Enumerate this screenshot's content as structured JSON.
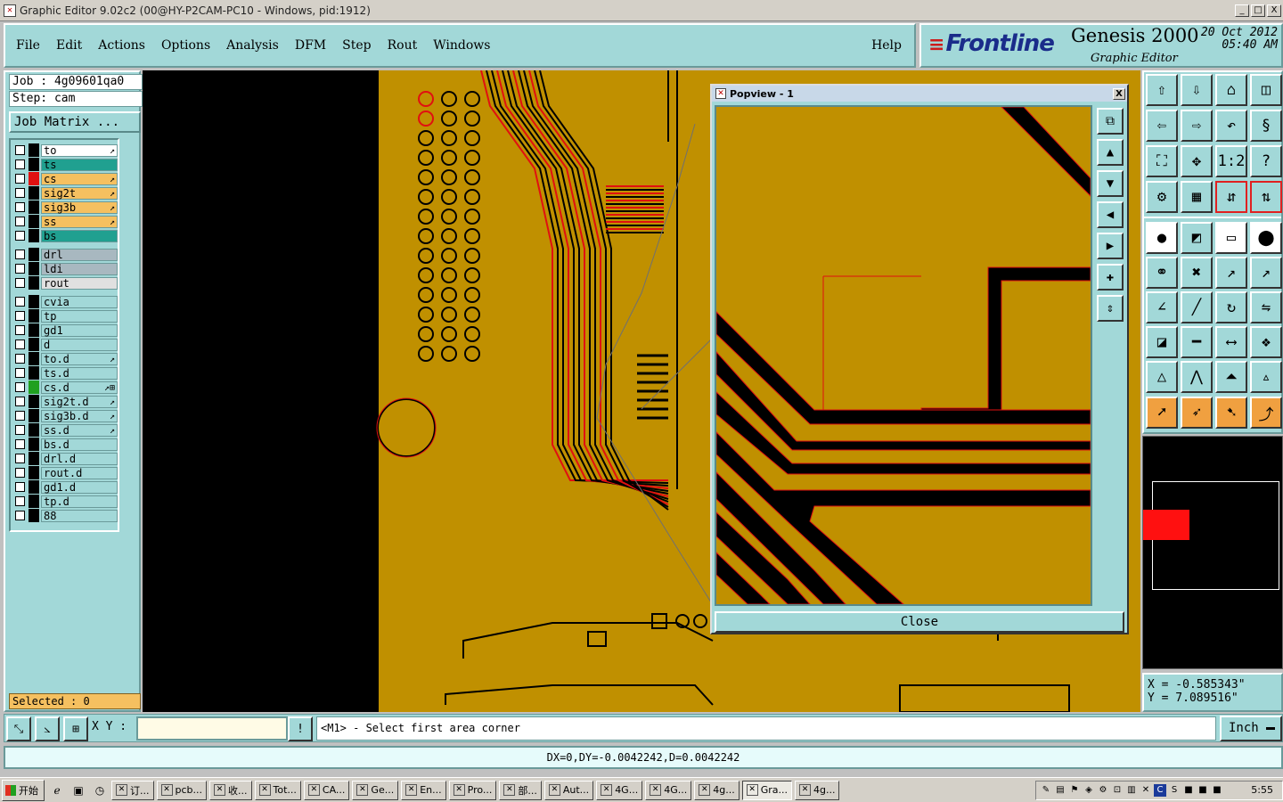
{
  "window": {
    "title": "Graphic Editor 9.02c2 (00@HY-P2CAM-PC10 - Windows, pid:1912)",
    "btn_min": "_",
    "btn_max": "□",
    "btn_close": "X"
  },
  "menu": {
    "file": "File",
    "edit": "Edit",
    "actions": "Actions",
    "options": "Options",
    "analysis": "Analysis",
    "dfm": "DFM",
    "step": "Step",
    "rout": "Rout",
    "windows": "Windows",
    "help": "Help"
  },
  "logo": {
    "brand": "Frontline",
    "product": "Genesis 2000",
    "subtitle": "Graphic Editor",
    "date": "20 Oct 2012",
    "time": "05:40 AM"
  },
  "panel": {
    "job": "Job : 4g09601qa0",
    "step": "Step: cam",
    "job_matrix": "Job Matrix ...",
    "selected": "Selected : 0"
  },
  "layers": [
    {
      "name": "to",
      "bg": "#ffffff",
      "swatch": "#000000",
      "flag": "↗"
    },
    {
      "name": "ts",
      "bg": "#20a090",
      "swatch": "#000000",
      "flag": ""
    },
    {
      "name": "cs",
      "bg": "#f5c060",
      "swatch": "#e01010",
      "flag": "↗"
    },
    {
      "name": "sig2t",
      "bg": "#f5c060",
      "swatch": "#000000",
      "flag": "↗"
    },
    {
      "name": "sig3b",
      "bg": "#f5c060",
      "swatch": "#000000",
      "flag": "↗"
    },
    {
      "name": "ss",
      "bg": "#f5c060",
      "swatch": "#000000",
      "flag": "↗"
    },
    {
      "name": "bs",
      "bg": "#20a090",
      "swatch": "#000000",
      "flag": ""
    },
    {
      "name": "drl",
      "bg": "#a8b8c0",
      "swatch": "#000000",
      "flag": ""
    },
    {
      "name": "ldi",
      "bg": "#a8b8c0",
      "swatch": "#000000",
      "flag": ""
    },
    {
      "name": "rout",
      "bg": "#e0e0e0",
      "swatch": "#000000",
      "flag": ""
    },
    {
      "name": "cvia",
      "bg": "#a2d8d8",
      "swatch": "#000000",
      "flag": ""
    },
    {
      "name": "tp",
      "bg": "#a2d8d8",
      "swatch": "#000000",
      "flag": ""
    },
    {
      "name": "gd1",
      "bg": "#a2d8d8",
      "swatch": "#000000",
      "flag": ""
    },
    {
      "name": "d",
      "bg": "#a2d8d8",
      "swatch": "#000000",
      "flag": ""
    },
    {
      "name": "to.d",
      "bg": "#a2d8d8",
      "swatch": "#000000",
      "flag": "↗"
    },
    {
      "name": "ts.d",
      "bg": "#a2d8d8",
      "swatch": "#000000",
      "flag": ""
    },
    {
      "name": "cs.d",
      "bg": "#a2d8d8",
      "swatch": "#20a020",
      "flag": "↗⊞"
    },
    {
      "name": "sig2t.d",
      "bg": "#a2d8d8",
      "swatch": "#000000",
      "flag": "↗"
    },
    {
      "name": "sig3b.d",
      "bg": "#a2d8d8",
      "swatch": "#000000",
      "flag": "↗"
    },
    {
      "name": "ss.d",
      "bg": "#a2d8d8",
      "swatch": "#000000",
      "flag": "↗"
    },
    {
      "name": "bs.d",
      "bg": "#a2d8d8",
      "swatch": "#000000",
      "flag": ""
    },
    {
      "name": "drl.d",
      "bg": "#a2d8d8",
      "swatch": "#000000",
      "flag": ""
    },
    {
      "name": "rout.d",
      "bg": "#a2d8d8",
      "swatch": "#000000",
      "flag": ""
    },
    {
      "name": "gd1.d",
      "bg": "#a2d8d8",
      "swatch": "#000000",
      "flag": ""
    },
    {
      "name": "tp.d",
      "bg": "#a2d8d8",
      "swatch": "#000000",
      "flag": ""
    },
    {
      "name": "88",
      "bg": "#a2d8d8",
      "swatch": "#000000",
      "flag": ""
    }
  ],
  "popview": {
    "title": "Popview - 1",
    "close_btn": "Close",
    "close_x": "X"
  },
  "coords": {
    "x": "X = -0.585343\"",
    "y": "Y = 7.089516\""
  },
  "command": {
    "xy_label": "X Y :",
    "xy_value": "",
    "prompt": "<M1> - Select first area corner",
    "units": "Inch"
  },
  "status": {
    "text": "DX=0,DY=-0.0042242,D=0.0042242"
  },
  "taskbar": {
    "start": "开始",
    "tasks": [
      "订...",
      "pcb...",
      "收...",
      "Tot...",
      "CA...",
      "Ge...",
      "En...",
      "Pro...",
      "部...",
      "Aut...",
      "4G...",
      "4G...",
      "4g...",
      "Gra...",
      "4g..."
    ],
    "clock": "5:55"
  },
  "colors": {
    "panel": "#a2d8d8",
    "copper": "#c09000",
    "trace_outline": "#e01010",
    "overview_highlight": "#ff1010"
  }
}
